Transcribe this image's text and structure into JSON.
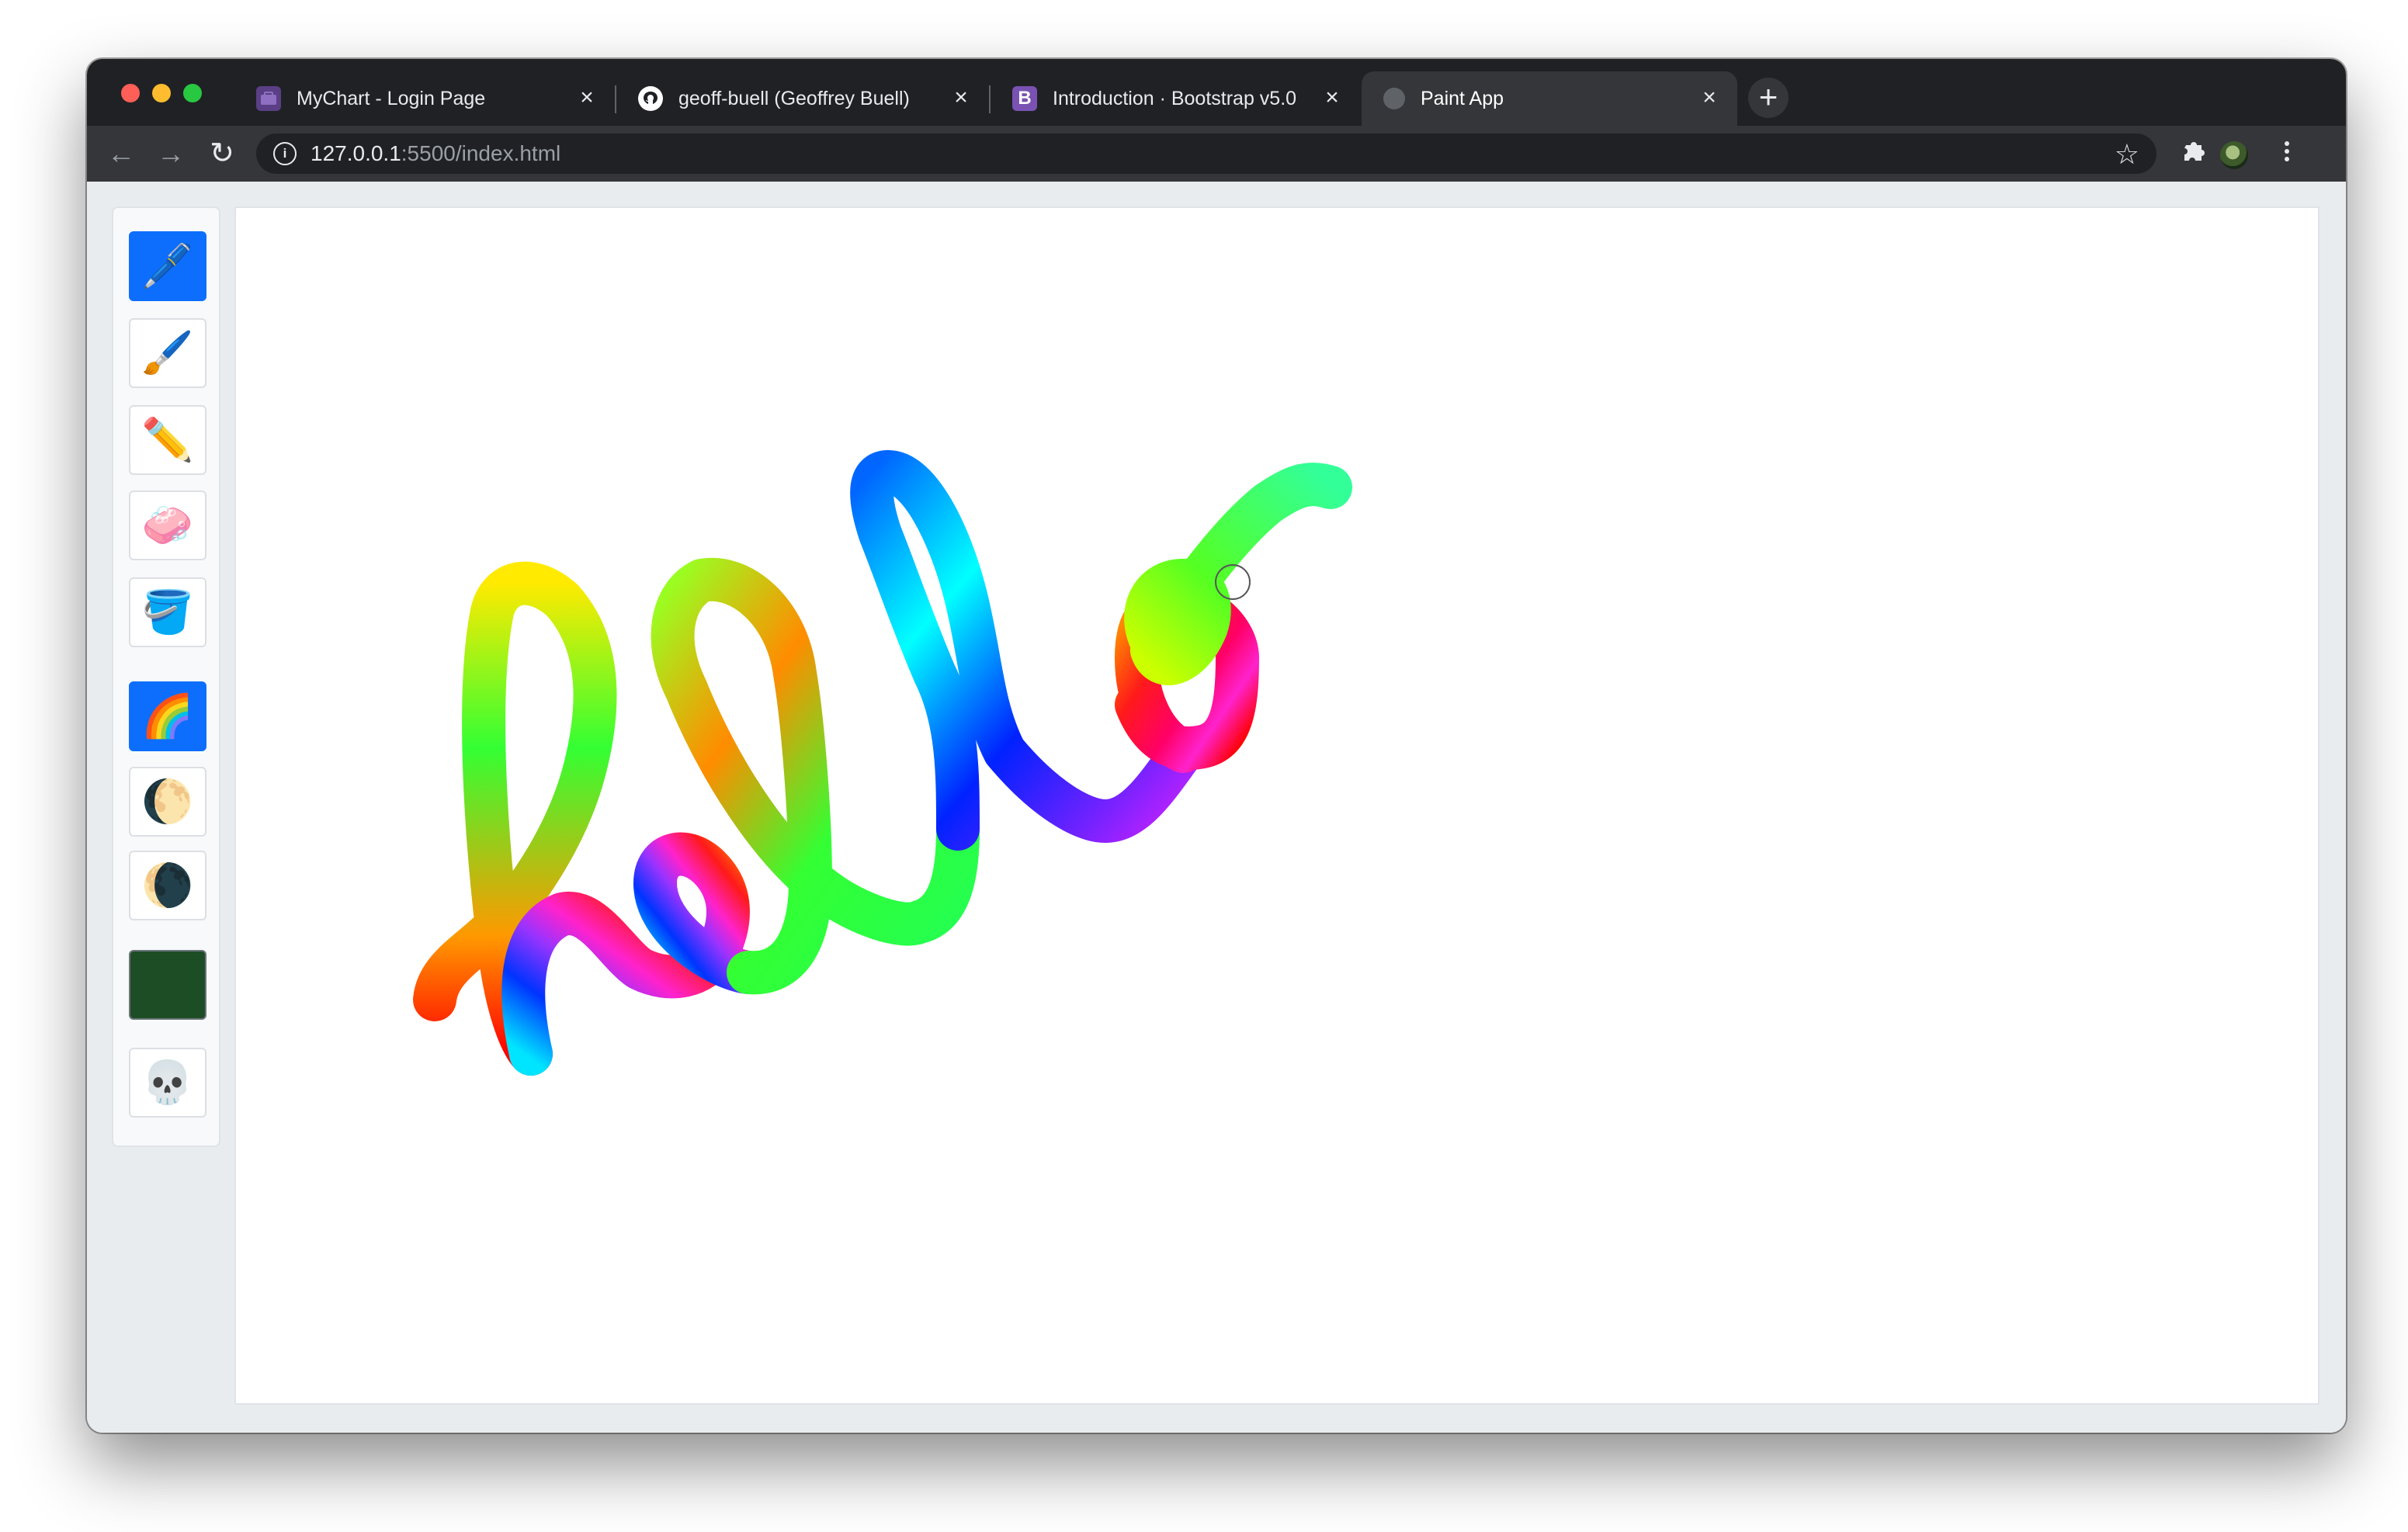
{
  "browser": {
    "tabs": [
      {
        "title": "MyChart - Login Page",
        "favicon": "mychart-icon",
        "active": false
      },
      {
        "title": "geoff-buell (Geoffrey Buell)",
        "favicon": "github-icon",
        "active": false
      },
      {
        "title": "Introduction · Bootstrap v5.0",
        "favicon": "bootstrap-icon",
        "active": false
      },
      {
        "title": "Paint App",
        "favicon": "globe-icon",
        "active": true
      }
    ],
    "address": {
      "host": "127.0.0.1",
      "path": ":5500/index.html"
    }
  },
  "toolbox": {
    "tools": [
      {
        "name": "pen",
        "icon": "🖊️",
        "active": true
      },
      {
        "name": "brush",
        "icon": "🖌️",
        "active": false
      },
      {
        "name": "pencil",
        "icon": "✏️",
        "active": false
      },
      {
        "name": "eraser",
        "icon": "🧼",
        "active": false
      },
      {
        "name": "fill-bucket",
        "icon": "🪣",
        "active": false
      },
      {
        "name": "rainbow",
        "icon": "🌈",
        "active": true
      },
      {
        "name": "light-mode",
        "icon": "🌔",
        "active": false
      },
      {
        "name": "dark-mode",
        "icon": "🌘",
        "active": false
      },
      {
        "name": "color-picker",
        "icon": "",
        "color": "#1d4d24",
        "active": false
      },
      {
        "name": "clear-canvas",
        "icon": "💀",
        "active": false
      }
    ]
  },
  "colors": {
    "accent": "#0d6efd",
    "selected_color": "#1d4d24"
  }
}
